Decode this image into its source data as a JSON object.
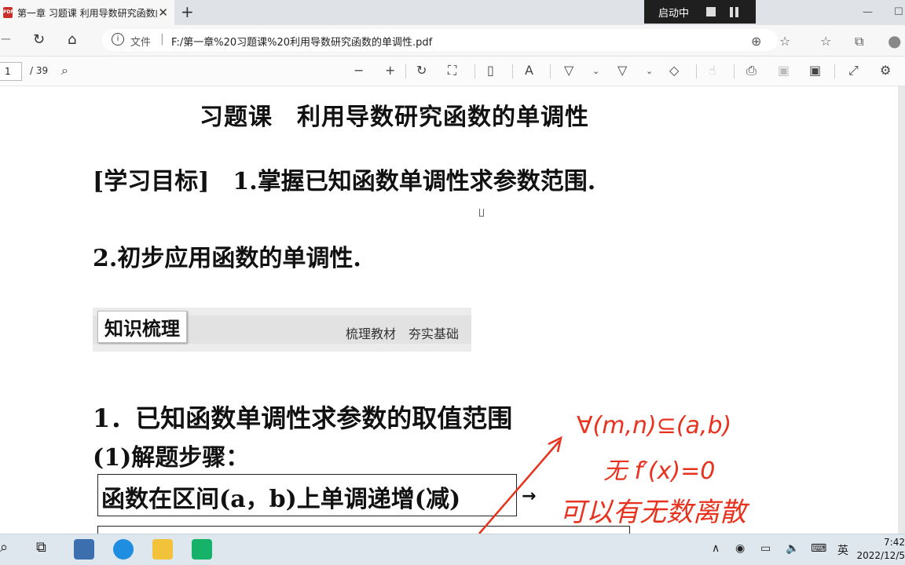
{
  "browser": {
    "tab_title": "第一章 习题课 利用导数研究函数的单调性.pdf",
    "tab_close": "✕",
    "new_tab": "+",
    "recorder_label": "启动中",
    "file_label": "文件",
    "separator": "|",
    "url": "F:/第一章%20习题课%20利用导数研究函数的单调性.pdf"
  },
  "pdf_toolbar": {
    "current_page": "1",
    "total_pages": "/ 39"
  },
  "document": {
    "title": "习题课　利用导数研究函数的单调性",
    "goal_label": "[学习目标]",
    "goal_1": "1.掌握已知函数单调性求参数范围.",
    "goal_2": "2.初步应用函数的单调性.",
    "section_chip": "知识梳理",
    "section_sub": "梳理教材　夯实基础",
    "heading_1": "1．已知函数单调性求参数的取值范围",
    "heading_2": "(1)解题步骤：",
    "box_text": "函数在区间(a，b)上单调递增(减)",
    "box_arrow": "→"
  },
  "handwriting": {
    "line1": "∀(m,n)⊆(a,b)",
    "line2": "无 f′(x)=0",
    "line3": "可以有无数离散",
    "color": "#e8321e"
  },
  "taskbar": {
    "ime": "英",
    "time": "7:42",
    "date": "2022/12/5"
  }
}
